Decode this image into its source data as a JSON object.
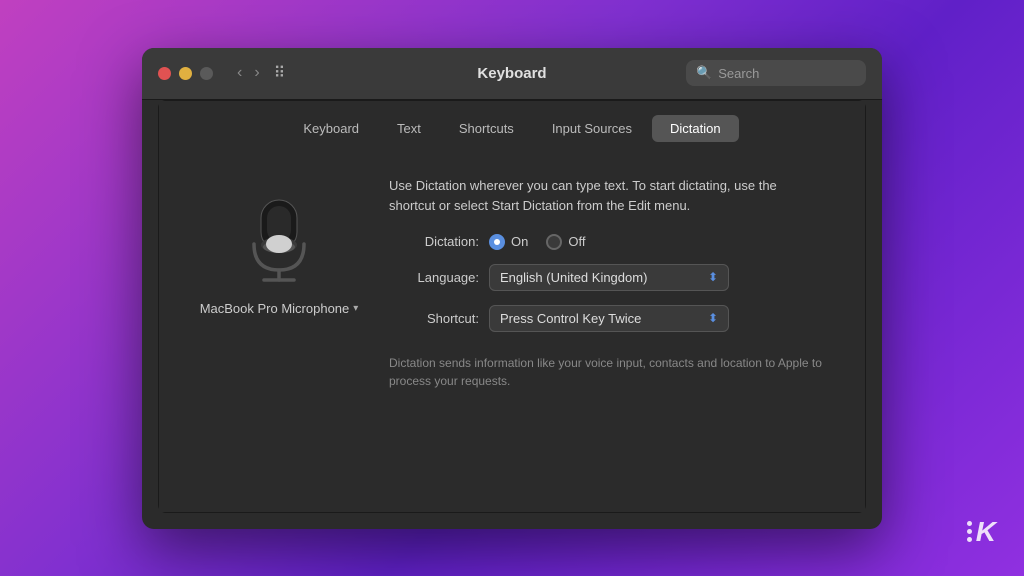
{
  "background": {
    "gradient_start": "#c040c0",
    "gradient_end": "#9030e0"
  },
  "window": {
    "title": "Keyboard"
  },
  "titlebar": {
    "title": "Keyboard",
    "search_placeholder": "Search",
    "back_arrow": "‹",
    "forward_arrow": "›",
    "controls": {
      "close_label": "close",
      "minimize_label": "minimize",
      "maximize_label": "maximize"
    }
  },
  "tabs": [
    {
      "id": "keyboard",
      "label": "Keyboard",
      "active": false
    },
    {
      "id": "text",
      "label": "Text",
      "active": false
    },
    {
      "id": "shortcuts",
      "label": "Shortcuts",
      "active": false
    },
    {
      "id": "input-sources",
      "label": "Input Sources",
      "active": false
    },
    {
      "id": "dictation",
      "label": "Dictation",
      "active": true
    }
  ],
  "content": {
    "description": "Use Dictation wherever you can type text. To start dictating, use the shortcut or select Start Dictation from the Edit menu.",
    "microphone_label": "MacBook Pro Microphone",
    "form": {
      "dictation_label": "Dictation:",
      "dictation_on": "On",
      "dictation_off": "Off",
      "dictation_selected": "on",
      "language_label": "Language:",
      "language_value": "English (United Kingdom)",
      "shortcut_label": "Shortcut:",
      "shortcut_value": "Press Control Key Twice"
    },
    "privacy_text": "Dictation sends information like your voice input, contacts and location to Apple to process your requests."
  },
  "logo": {
    "letter": "K"
  }
}
